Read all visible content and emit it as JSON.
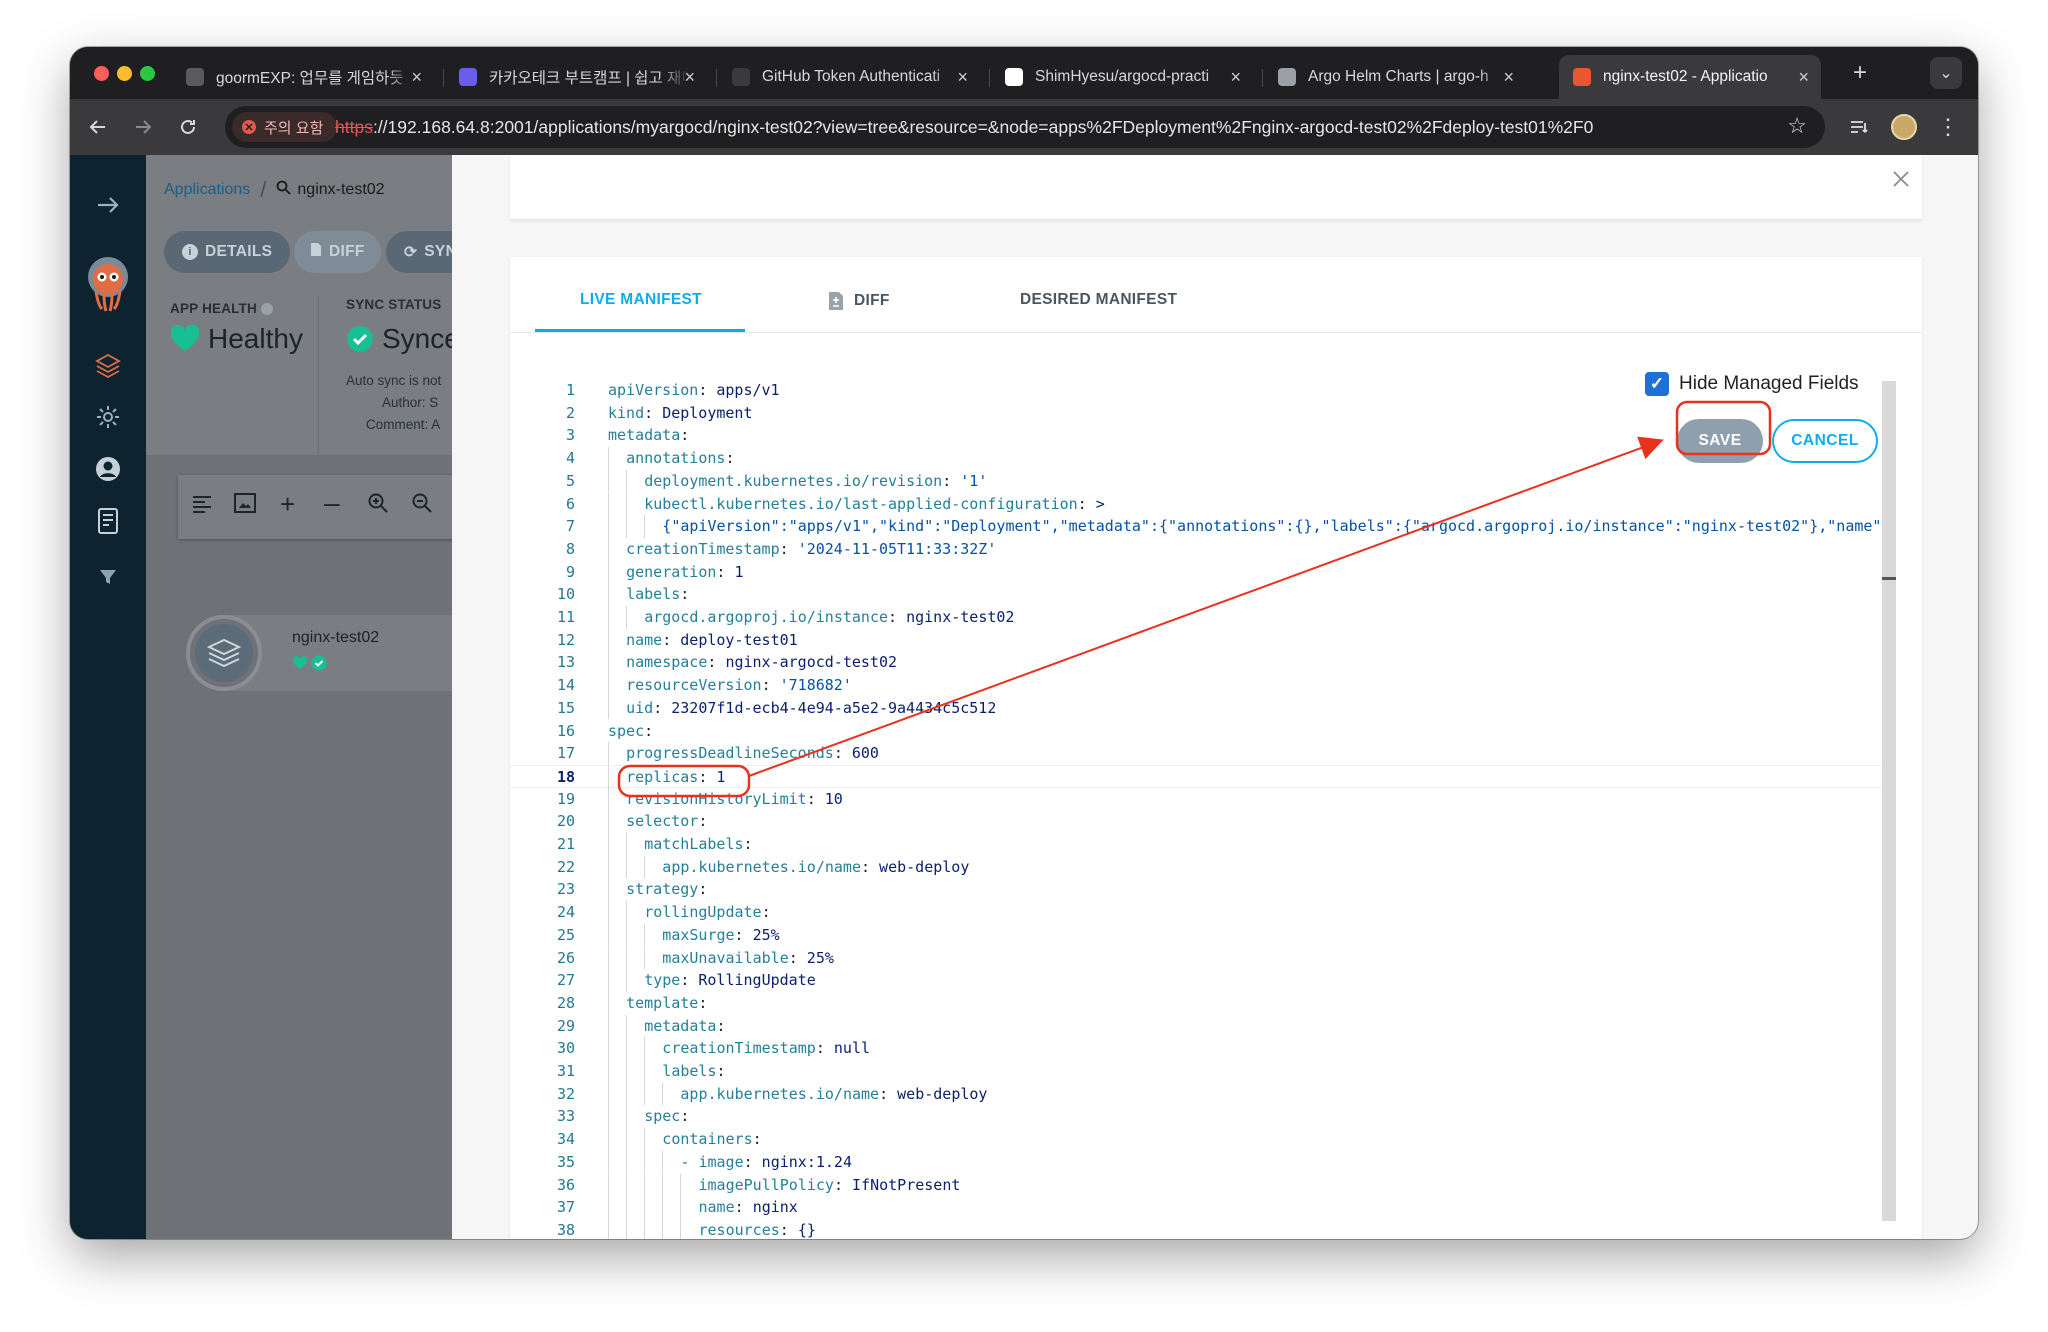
{
  "browser": {
    "tabs": [
      {
        "title": "goormEXP: 업무를 게임하듯",
        "icon": "goorm-icon",
        "fav_color": "#5a5a5e"
      },
      {
        "title": "카카오테크 부트캠프 | 쉽고 재미",
        "icon": "kakao-icon",
        "fav_color": "#6b5cf0"
      },
      {
        "title": "GitHub Token Authenticati",
        "icon": "github-token-icon",
        "fav_color": "#3a3a3d"
      },
      {
        "title": "ShimHyesu/argocd-practi",
        "icon": "github-icon",
        "fav_color": "#ffffff"
      },
      {
        "title": "Argo Helm Charts | argo-h",
        "icon": "globe-icon",
        "fav_color": "#9aa0a6"
      },
      {
        "title": "nginx-test02 - Applicatio",
        "icon": "argo-icon",
        "fav_color": "#e8572e",
        "active": true
      }
    ],
    "new_tab": "+",
    "tab_menu": "⌄",
    "warning_chip": "주의 요함",
    "url_scheme": "https",
    "url_rest": "://192.168.64.8:2001/applications/myargocd/nginx-test02?view=tree&resource=&node=apps%2FDeployment%2Fnginx-argocd-test02%2Fdeploy-test01%2F0"
  },
  "app": {
    "breadcrumb_root": "Applications",
    "breadcrumb_sep": "/",
    "breadcrumb_current": "nginx-test02",
    "buttons": {
      "details": "DETAILS",
      "diff": "DIFF",
      "sync": "SYNC"
    },
    "app_health_label": "APP HEALTH",
    "health_value": "Healthy",
    "sync_status_label": "SYNC STATUS",
    "sync_value": "Synced",
    "auto_sync_text": "Auto sync is not",
    "author_label": "Author:",
    "author_value": "S",
    "comment_label": "Comment:",
    "comment_value": "A",
    "node_name": "nginx-test02",
    "health_color": "#18be94",
    "sync_color": "#18be94"
  },
  "panel": {
    "tabs": {
      "live": "LIVE MANIFEST",
      "diff": "DIFF",
      "desired": "DESIRED MANIFEST"
    },
    "hide_managed_fields": "Hide Managed Fields",
    "hide_managed_checked": true,
    "save": "SAVE",
    "cancel": "CANCEL",
    "accent": "#0dadea"
  },
  "code_lines": [
    {
      "n": "1",
      "indent": 0,
      "key": "apiVersion",
      "val": "apps/v1"
    },
    {
      "n": "2",
      "indent": 0,
      "key": "kind",
      "val": "Deployment"
    },
    {
      "n": "3",
      "indent": 0,
      "key": "metadata",
      "val": ""
    },
    {
      "n": "4",
      "indent": 1,
      "key": "annotations",
      "val": ""
    },
    {
      "n": "5",
      "indent": 2,
      "key": "deployment.kubernetes.io/revision",
      "val": "'1'"
    },
    {
      "n": "6",
      "indent": 2,
      "key": "kubectl.kubernetes.io/last-applied-configuration",
      "val": ">"
    },
    {
      "n": "7",
      "indent": 3,
      "raw": "{\"apiVersion\":\"apps/v1\",\"kind\":\"Deployment\",\"metadata\":{\"annotations\":{},\"labels\":{\"argocd.argoproj.io/instance\":\"nginx-test02\"},\"name\":"
    },
    {
      "n": "8",
      "indent": 1,
      "key": "creationTimestamp",
      "val": "'2024-11-05T11:33:32Z'"
    },
    {
      "n": "9",
      "indent": 1,
      "key": "generation",
      "val": "1"
    },
    {
      "n": "10",
      "indent": 1,
      "key": "labels",
      "val": ""
    },
    {
      "n": "11",
      "indent": 2,
      "key": "argocd.argoproj.io/instance",
      "val": "nginx-test02"
    },
    {
      "n": "12",
      "indent": 1,
      "key": "name",
      "val": "deploy-test01"
    },
    {
      "n": "13",
      "indent": 1,
      "key": "namespace",
      "val": "nginx-argocd-test02"
    },
    {
      "n": "14",
      "indent": 1,
      "key": "resourceVersion",
      "val": "'718682'"
    },
    {
      "n": "15",
      "indent": 1,
      "key": "uid",
      "val": "23207f1d-ecb4-4e94-a5e2-9a4434c5c512"
    },
    {
      "n": "16",
      "indent": 0,
      "key": "spec",
      "val": ""
    },
    {
      "n": "17",
      "indent": 1,
      "key": "progressDeadlineSeconds",
      "val": "600"
    },
    {
      "n": "18",
      "indent": 1,
      "key": "replicas",
      "val": "1",
      "current": true
    },
    {
      "n": "19",
      "indent": 1,
      "key": "revisionHistoryLimit",
      "val": "10"
    },
    {
      "n": "20",
      "indent": 1,
      "key": "selector",
      "val": ""
    },
    {
      "n": "21",
      "indent": 2,
      "key": "matchLabels",
      "val": ""
    },
    {
      "n": "22",
      "indent": 3,
      "key": "app.kubernetes.io/name",
      "val": "web-deploy"
    },
    {
      "n": "23",
      "indent": 1,
      "key": "strategy",
      "val": ""
    },
    {
      "n": "24",
      "indent": 2,
      "key": "rollingUpdate",
      "val": ""
    },
    {
      "n": "25",
      "indent": 3,
      "key": "maxSurge",
      "val": "25%"
    },
    {
      "n": "26",
      "indent": 3,
      "key": "maxUnavailable",
      "val": "25%"
    },
    {
      "n": "27",
      "indent": 2,
      "key": "type",
      "val": "RollingUpdate"
    },
    {
      "n": "28",
      "indent": 1,
      "key": "template",
      "val": ""
    },
    {
      "n": "29",
      "indent": 2,
      "key": "metadata",
      "val": ""
    },
    {
      "n": "30",
      "indent": 3,
      "key": "creationTimestamp",
      "val": "null"
    },
    {
      "n": "31",
      "indent": 3,
      "key": "labels",
      "val": ""
    },
    {
      "n": "32",
      "indent": 4,
      "key": "app.kubernetes.io/name",
      "val": "web-deploy"
    },
    {
      "n": "33",
      "indent": 2,
      "key": "spec",
      "val": ""
    },
    {
      "n": "34",
      "indent": 3,
      "key": "containers",
      "val": ""
    },
    {
      "n": "35",
      "indent": 4,
      "key": "- image",
      "val": "nginx:1.24"
    },
    {
      "n": "36",
      "indent": 5,
      "key": "imagePullPolicy",
      "val": "IfNotPresent"
    },
    {
      "n": "37",
      "indent": 5,
      "key": "name",
      "val": "nginx"
    },
    {
      "n": "38",
      "indent": 5,
      "key": "resources",
      "val": "{}"
    }
  ],
  "annotation_color": "#e8321e"
}
